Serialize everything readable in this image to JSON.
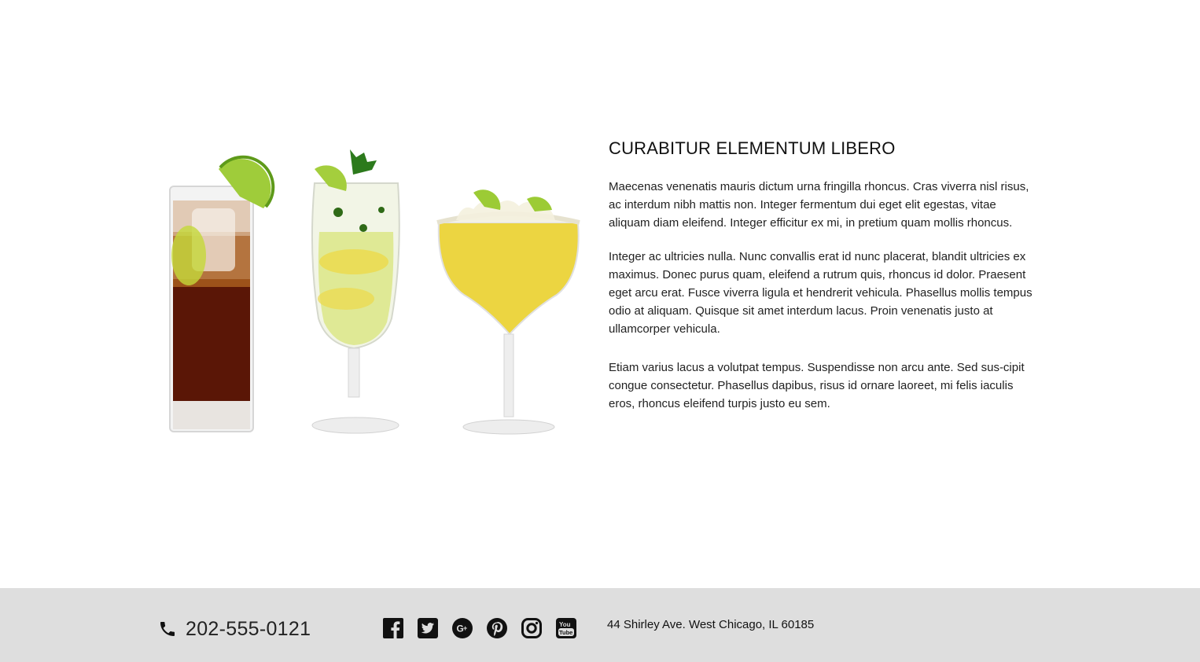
{
  "main": {
    "heading": "CURABITUR ELEMENTUM LIBERO",
    "paragraphs": [
      "Maecenas venenatis mauris dictum urna fringilla rhoncus. Cras viverra nisl risus, ac interdum nibh mattis non. Integer fermentum dui eget elit egestas, vitae aliquam diam eleifend. Integer efficitur ex mi, in pretium quam mollis rhoncus.",
      "Integer ac ultricies nulla. Nunc convallis erat id nunc placerat, blandit ultricies ex maximus. Donec purus quam, eleifend a rutrum quis, rhoncus id dolor. Praesent eget arcu erat. Fusce viverra ligula et hendrerit vehicula. Phasellus mollis tempus odio at aliquam. Quisque sit amet interdum lacus. Proin venenatis justo at ullamcorper vehicula.",
      "Etiam varius lacus a volutpat tempus. Suspendisse non arcu ante. Sed sus-cipit congue consectetur. Phasellus dapibus, risus id ornare laoreet, mi felis iaculis eros, rhoncus eleifend turpis justo eu sem."
    ]
  },
  "footer": {
    "phone": "202-555-0121",
    "address": "44 Shirley Ave. West Chicago, IL 60185",
    "socials": [
      "facebook-icon",
      "twitter-icon",
      "google-plus-icon",
      "pinterest-icon",
      "instagram-icon",
      "youtube-icon"
    ]
  },
  "colors": {
    "footer_bg": "#dedede",
    "text": "#222222"
  }
}
